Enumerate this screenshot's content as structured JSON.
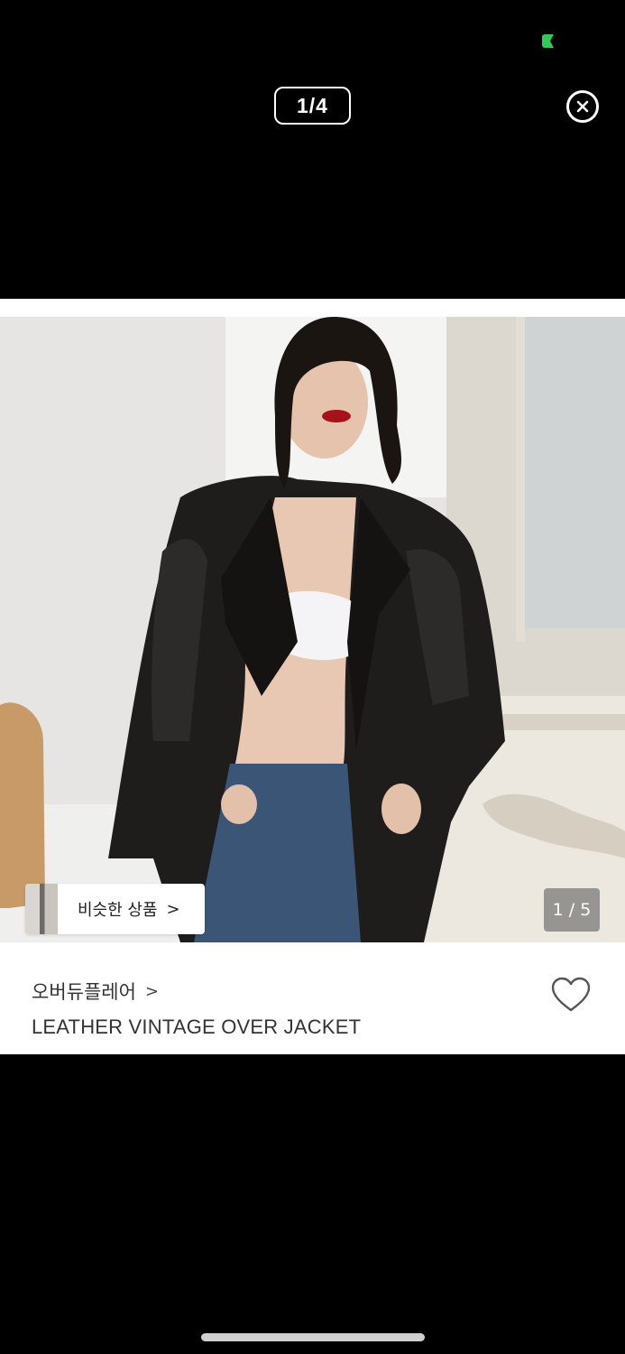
{
  "viewer": {
    "page_counter": "1/4",
    "close_icon": "close-circle-icon"
  },
  "product_card": {
    "similar_button_label": "비슷한 상품",
    "similar_arrow": ">",
    "image_counter": "1 / 5",
    "brand_name": "오버듀플레어",
    "brand_arrow": ">",
    "product_name": "LEATHER VINTAGE OVER JACKET",
    "heart_icon": "heart-outline-icon"
  },
  "colors": {
    "background": "#000000",
    "card": "#ffffff",
    "status_indicator": "#34c759"
  }
}
